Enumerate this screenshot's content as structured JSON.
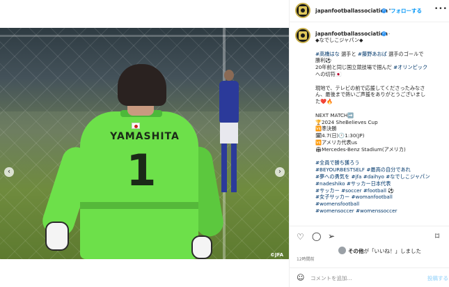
{
  "photo": {
    "jersey_name": "YAMASHITA",
    "jersey_number": "1",
    "credit": "©JFA",
    "nav_prev": "‹",
    "nav_next": "›"
  },
  "header": {
    "username": "japanfootballassociation",
    "verified_badge": "✓",
    "separator": "•",
    "follow_label": "フォローする",
    "more_label": "•••"
  },
  "caption": {
    "username": "japanfootballassociation",
    "verified_badge": "✓",
    "separator": ".",
    "lines": [
      "◆なでしこジャパン◆",
      "",
      "#高橋はな 選手と #藤野あおば 選手のゴールで",
      "勝利⚽",
      "20年前と同じ国立競技場で掴んだ #オリンピック",
      "への切符🇯🇵",
      "",
      "現地で、テレビの前で応援してくださったみなさ",
      "ん、最後まで熱いご声援をありがとうございまし",
      "た❤️🔥",
      "",
      "NEXT MATCH➡️",
      "🏆2024 SheBelieves Cup",
      "🆚準決勝",
      "🗓4.7(日)🕐1:30(JP)",
      "🆚アメリカ代表us",
      "🏟Mercedes-Benz Stadium(アメリカ)",
      "",
      "#全員で勝ち獲ろう",
      "#BEYOURBESTSELF #最高の自分であれ",
      "#夢への勇気を #jfa #daihyo #なでしこジャパン",
      "#nadeshiko #サッカー日本代表",
      "#サッカー #soccer #football ⚽",
      "#女子サッカー #womanfootball",
      "#womensfootball",
      "#womensoccer #womenssoccer"
    ]
  },
  "actions": {
    "heart_icon": "♡",
    "comment_icon": "◯",
    "share_icon": "➢",
    "bookmark_icon": "⌑",
    "likes_prefix": "",
    "likes_name": "その他",
    "likes_suffix": "が「いいね！」しました",
    "time": "12時間前"
  },
  "comment_box": {
    "emoji_icon": "☺",
    "placeholder": "コメントを追加...",
    "post_label": "投稿する"
  },
  "colors": {
    "accent": "#0095f6",
    "hashtag": "#00376b",
    "kit": "#6de04a"
  }
}
